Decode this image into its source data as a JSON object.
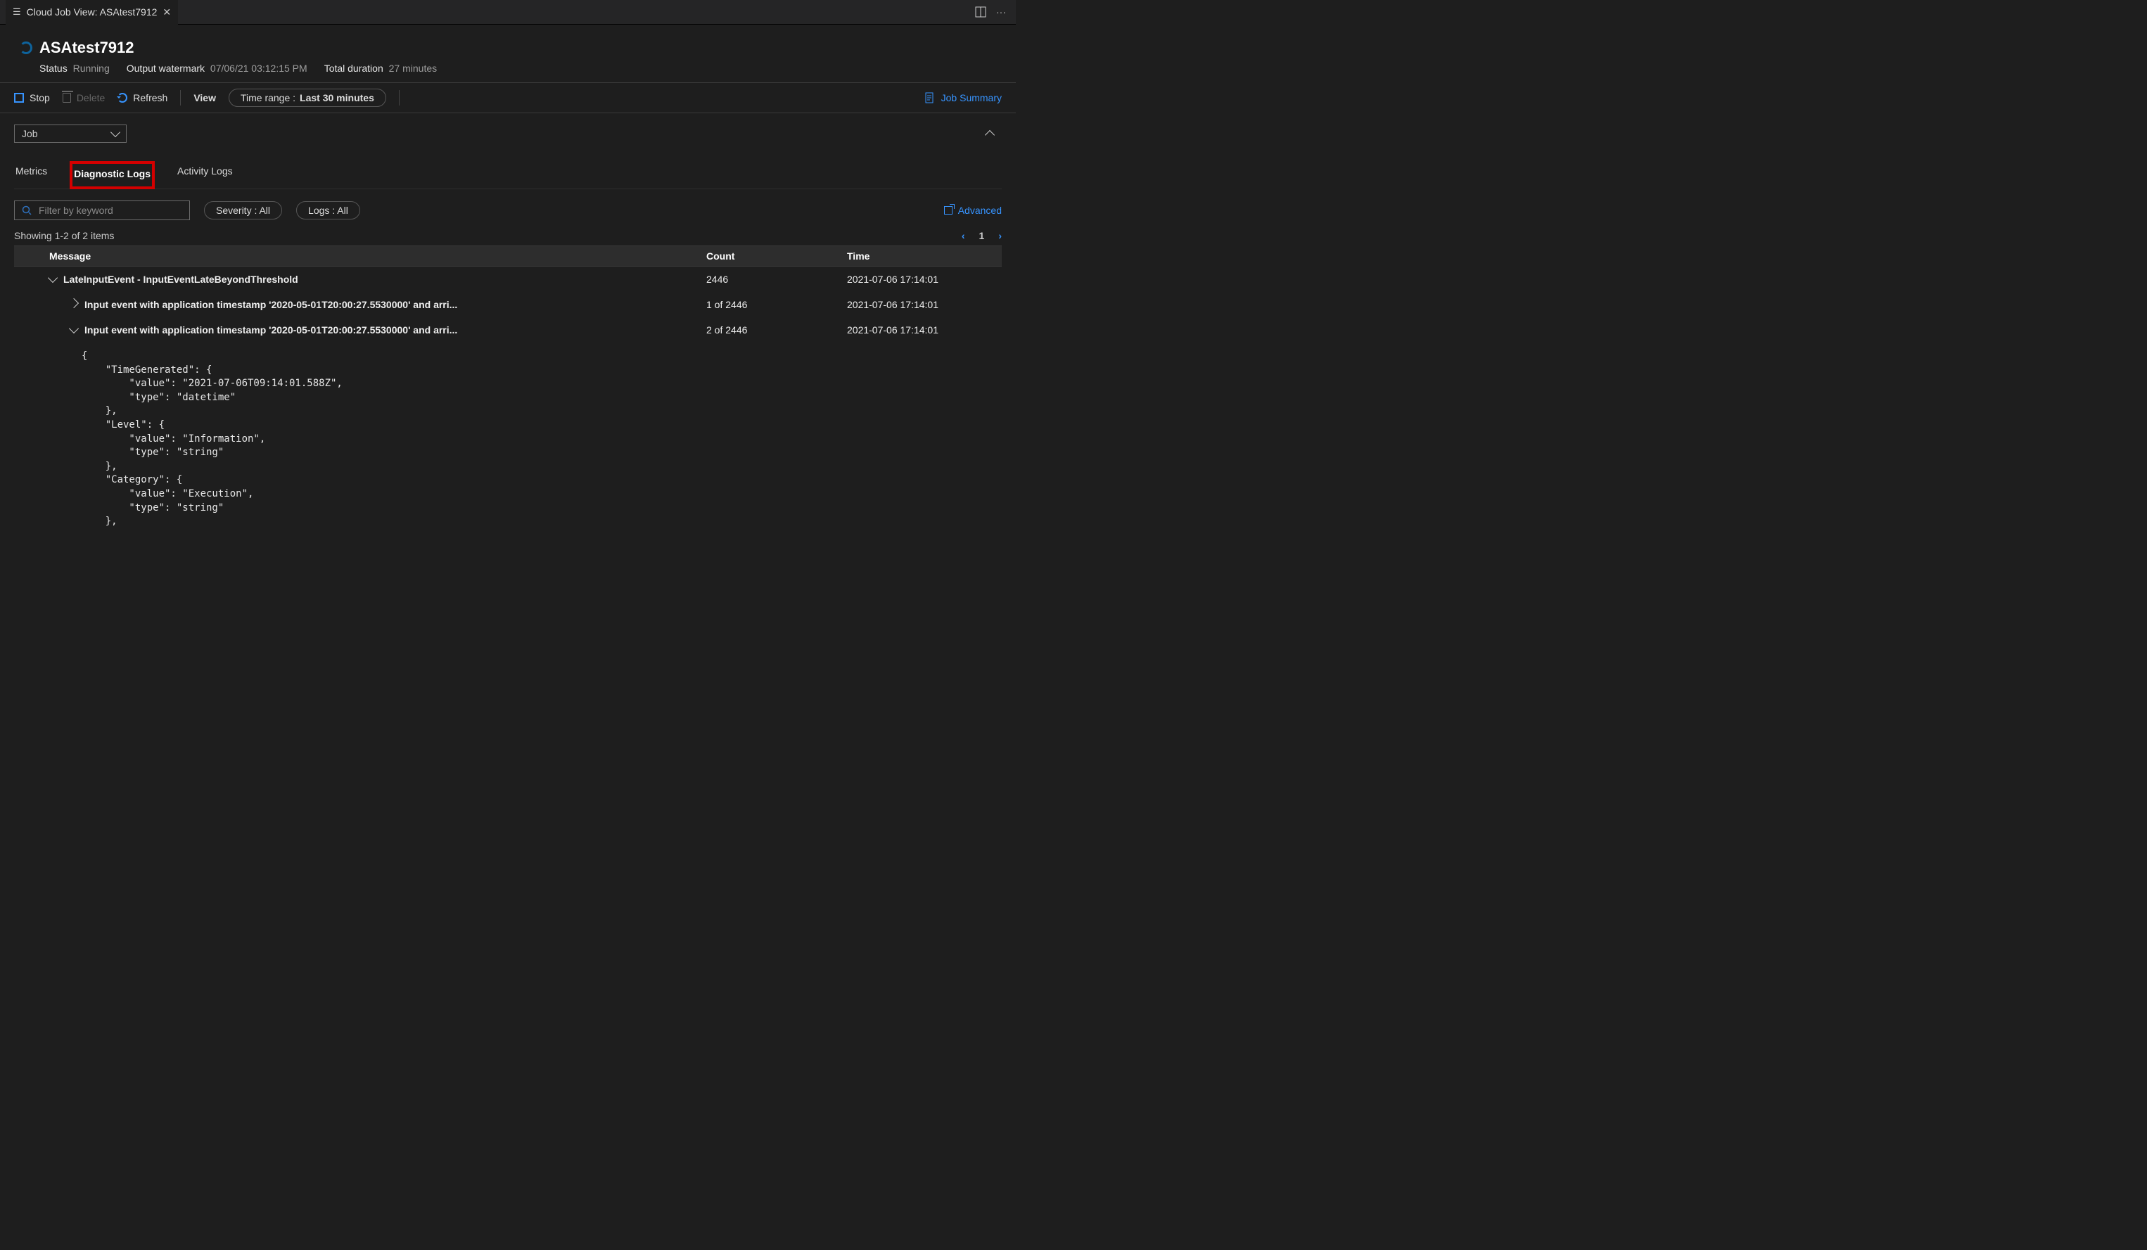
{
  "tab": {
    "title": "Cloud Job View: ASAtest7912"
  },
  "header": {
    "job_title": "ASAtest7912",
    "status_label": "Status",
    "status_value": "Running",
    "watermark_label": "Output watermark",
    "watermark_value": "07/06/21 03:12:15 PM",
    "duration_label": "Total duration",
    "duration_value": "27 minutes"
  },
  "toolbar": {
    "stop": "Stop",
    "delete": "Delete",
    "refresh": "Refresh",
    "view": "View",
    "time_label": "Time range :",
    "time_value": "Last 30 minutes",
    "summary": "Job Summary"
  },
  "scope_select": "Job",
  "tabs": {
    "metrics": "Metrics",
    "diag": "Diagnostic Logs",
    "activity": "Activity Logs"
  },
  "filter": {
    "placeholder": "Filter by keyword",
    "severity": "Severity : All",
    "logs": "Logs : All",
    "advanced": "Advanced"
  },
  "showing": "Showing 1-2 of 2 items",
  "page": "1",
  "columns": {
    "message": "Message",
    "count": "Count",
    "time": "Time"
  },
  "rows": [
    {
      "level": 0,
      "expanded": true,
      "msg": "LateInputEvent - InputEventLateBeyondThreshold",
      "count": "2446",
      "time": "2021-07-06 17:14:01",
      "bold": true
    },
    {
      "level": 1,
      "expanded": false,
      "msg": "Input event with application timestamp '2020-05-01T20:00:27.5530000' and arri...",
      "count": "1 of 2446",
      "time": "2021-07-06 17:14:01",
      "bold": true
    },
    {
      "level": 1,
      "expanded": true,
      "msg": "Input event with application timestamp '2020-05-01T20:00:27.5530000' and arri...",
      "count": "2 of 2446",
      "time": "2021-07-06 17:14:01",
      "bold": true
    }
  ],
  "json_detail": "{\n    \"TimeGenerated\": {\n        \"value\": \"2021-07-06T09:14:01.588Z\",\n        \"type\": \"datetime\"\n    },\n    \"Level\": {\n        \"value\": \"Information\",\n        \"type\": \"string\"\n    },\n    \"Category\": {\n        \"value\": \"Execution\",\n        \"type\": \"string\"\n    },"
}
